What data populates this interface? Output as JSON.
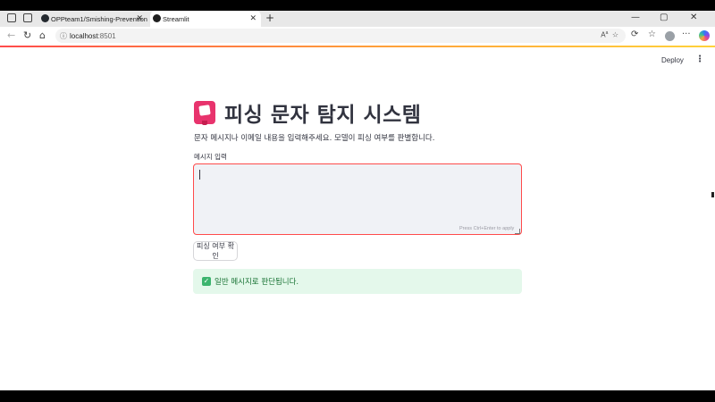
{
  "browser": {
    "tabs": [
      {
        "label": "OPPteam1/Smishing-Prevention"
      },
      {
        "label": "Streamlit"
      }
    ],
    "url_host": "localhost",
    "url_port": ":8501",
    "icons": [
      "workspaces-icon",
      "tab-actions-icon",
      "github-icon",
      "streamlit-icon",
      "back-icon",
      "reload-icon",
      "home-icon",
      "info-icon",
      "read-aloud-icon",
      "favorite-icon",
      "extensions-icon",
      "favorites-bar-icon",
      "profile-icon",
      "more-icon",
      "copilot-icon"
    ]
  },
  "header": {
    "deploy_label": "Deploy",
    "menu_icon": "kebab-icon"
  },
  "app": {
    "title": "피싱 문자 탐지 시스템",
    "subtitle": "문자 메시지나 이메일 내용을 입력해주세요. 모델이 피싱 여부를 판별합니다.",
    "input_label": "메시지 입력",
    "input_value": "",
    "input_hint": "Press Ctrl+Enter to apply",
    "button_label": "피싱 여부 확인",
    "result_text": "일반 메시지로 판단됩니다."
  },
  "colors": {
    "accent": "#ff4b4b",
    "success_bg": "#e4f8eb",
    "success_text": "#177233",
    "title_icon": "#e8336d"
  }
}
